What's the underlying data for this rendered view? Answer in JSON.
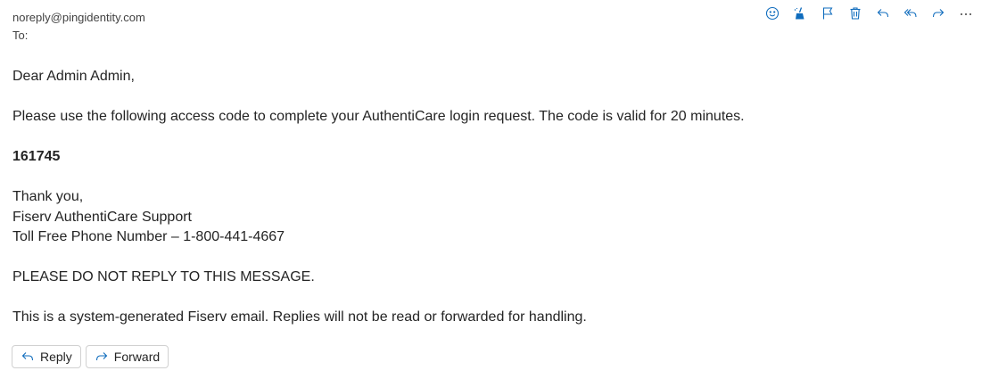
{
  "header": {
    "from": "noreply@pingidentity.com",
    "to_label": "To:"
  },
  "toolbar": {
    "icons": [
      "emoji-icon",
      "sweep-icon",
      "flag-icon",
      "trash-icon",
      "reply-icon",
      "reply-all-icon",
      "forward-icon",
      "more-icon"
    ],
    "accent": "#0f6cbd"
  },
  "message": {
    "greeting": "Dear Admin Admin,",
    "instruction": "Please use the following access code to complete your AuthentiCare login request. The code is valid for 20 minutes.",
    "code": "161745",
    "thanks": "Thank you,",
    "signature_name": "Fiserv AuthentiCare Support",
    "signature_phone": "Toll Free Phone Number – 1-800-441-4667",
    "warning": "PLEASE DO NOT REPLY TO THIS MESSAGE.",
    "disclaimer": "This is a system-generated Fiserv email. Replies will not be read or forwarded for handling."
  },
  "actions": {
    "reply_label": "Reply",
    "forward_label": "Forward"
  }
}
